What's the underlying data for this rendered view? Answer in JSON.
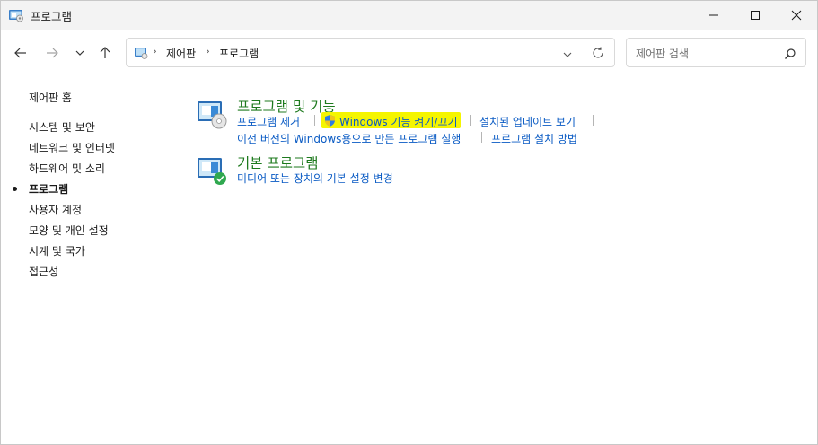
{
  "window": {
    "title": "프로그램"
  },
  "address_bar": {
    "crumbs": [
      "제어판",
      "프로그램"
    ]
  },
  "search": {
    "placeholder": "제어판 검색"
  },
  "sidebar": {
    "items": [
      {
        "label": "제어판 홈",
        "active": false
      },
      {
        "label": "시스템 및 보안",
        "active": false
      },
      {
        "label": "네트워크 및 인터넷",
        "active": false
      },
      {
        "label": "하드웨어 및 소리",
        "active": false
      },
      {
        "label": "프로그램",
        "active": true
      },
      {
        "label": "사용자 계정",
        "active": false
      },
      {
        "label": "모양 및 개인 설정",
        "active": false
      },
      {
        "label": "시계 및 국가",
        "active": false
      },
      {
        "label": "접근성",
        "active": false
      }
    ]
  },
  "sections": [
    {
      "title": "프로그램 및 기능",
      "links": [
        "프로그램 제거",
        "Windows 기능 켜기/끄기",
        "설치된 업데이트 보기",
        "이전 버전의 Windows용으로 만든 프로그램 실행",
        "프로그램 설치 방법"
      ]
    },
    {
      "title": "기본 프로그램",
      "links": [
        "미디어 또는 장치의 기본 설정 변경"
      ]
    }
  ],
  "colors": {
    "section_title": "#1e7a1e",
    "link": "#0a5bc4",
    "highlight": "#f5f500",
    "titlebar_bg": "#f3f3f3"
  }
}
